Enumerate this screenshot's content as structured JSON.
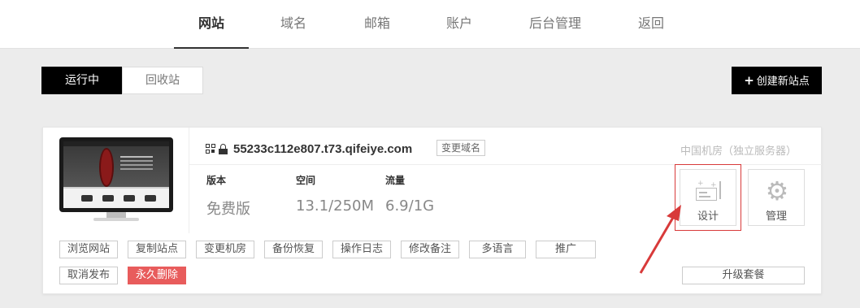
{
  "nav": {
    "items": [
      {
        "label": "网站",
        "active": true
      },
      {
        "label": "域名",
        "active": false
      },
      {
        "label": "邮箱",
        "active": false
      },
      {
        "label": "账户",
        "active": false
      },
      {
        "label": "后台管理",
        "active": false
      },
      {
        "label": "返回",
        "active": false
      }
    ]
  },
  "tabs": {
    "running": "运行中",
    "recycle": "回收站"
  },
  "create_button": {
    "icon": "plus-icon",
    "label": "创建新站点"
  },
  "site": {
    "domain": "55233c112e807.t73.qifeiye.com",
    "change_domain_label": "变更域名",
    "server_location": "中国机房（独立服务器）",
    "stats": {
      "version_label": "版本",
      "version_value": "免费版",
      "space_label": "空间",
      "space_value": "13.1/250M",
      "traffic_label": "流量",
      "traffic_value": "6.9/1G"
    },
    "design_label": "设计",
    "manage_label": "管理",
    "actions": [
      "浏览网站",
      "复制站点",
      "变更机房",
      "备份恢复",
      "操作日志",
      "修改备注",
      "多语言",
      "推广"
    ],
    "cancel_publish_label": "取消发布",
    "delete_label": "永久删除",
    "upgrade_label": "升级套餐"
  },
  "colors": {
    "accent": "#000000",
    "danger": "#e85c5c",
    "highlight": "#d83a3a"
  }
}
